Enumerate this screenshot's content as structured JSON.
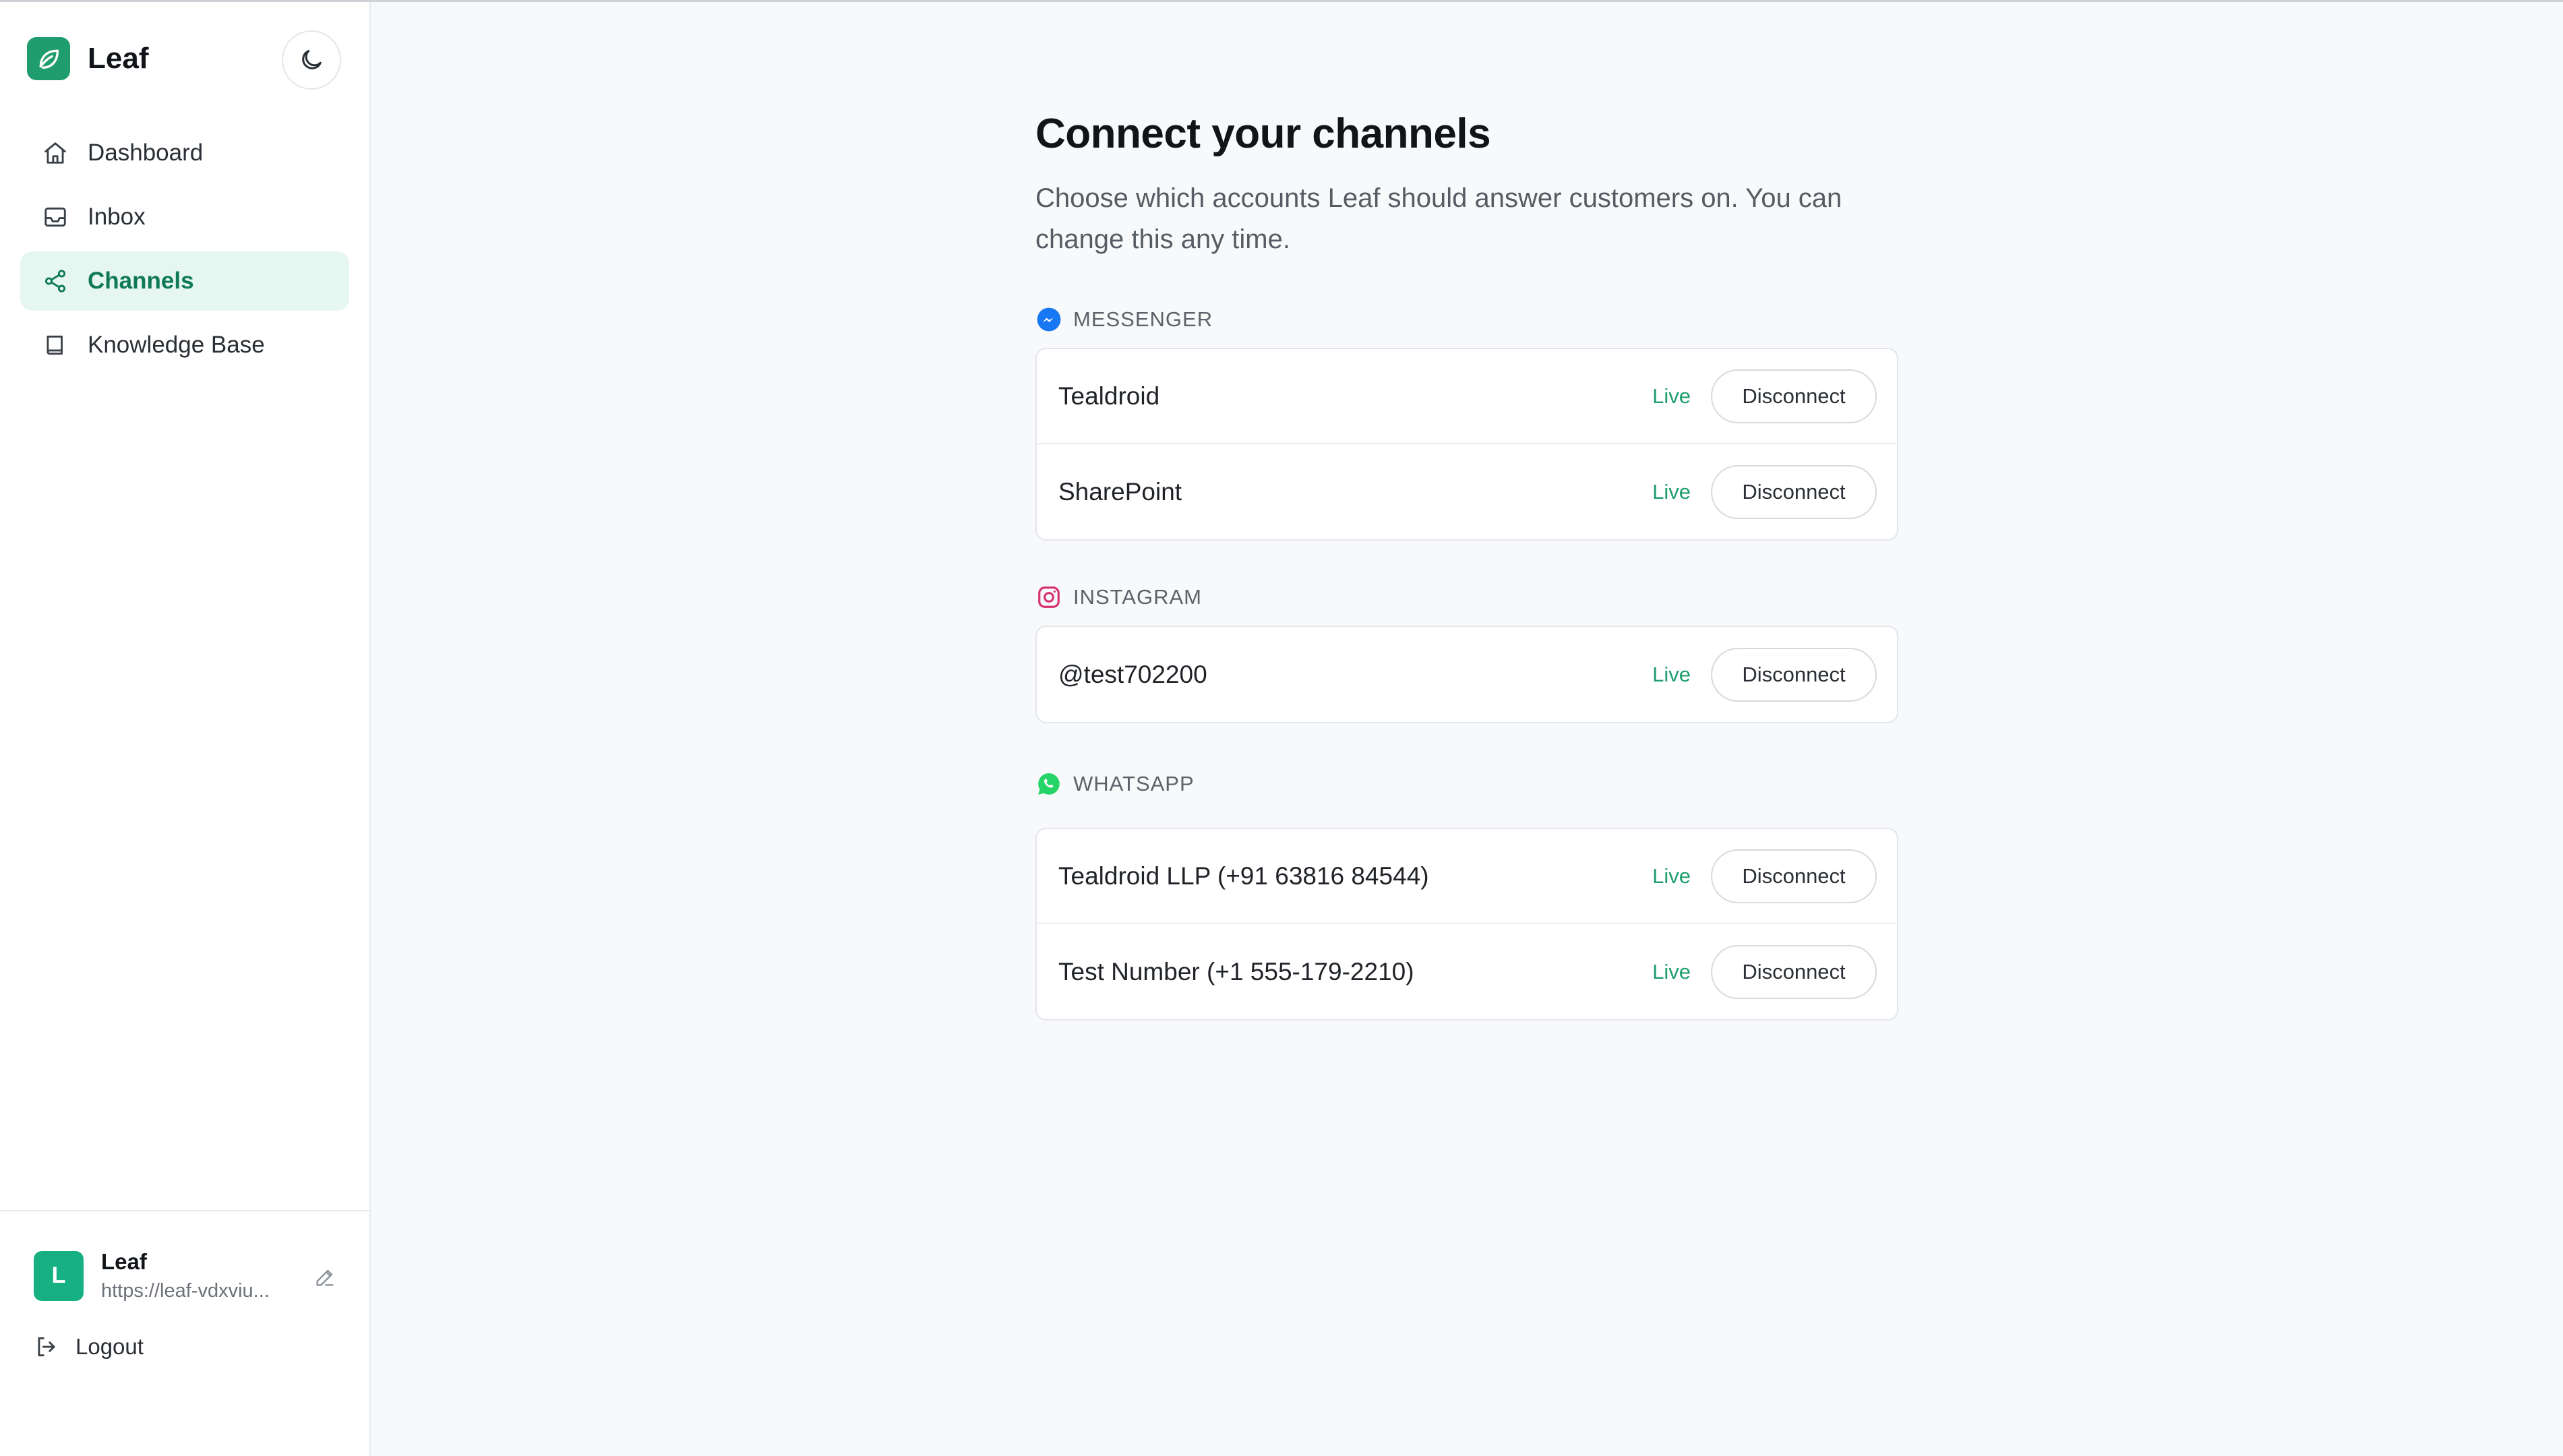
{
  "brand": {
    "name": "Leaf",
    "accent": "#1f9d6e"
  },
  "sidebar": {
    "items": [
      {
        "label": "Dashboard",
        "icon": "home-icon"
      },
      {
        "label": "Inbox",
        "icon": "inbox-icon"
      },
      {
        "label": "Channels",
        "icon": "share-icon",
        "active": true
      },
      {
        "label": "Knowledge Base",
        "icon": "book-icon"
      }
    ],
    "theme_toggle_icon": "moon-icon"
  },
  "account": {
    "avatar_letter": "L",
    "name": "Leaf",
    "url": "https://leaf-vdxviu..."
  },
  "logout_label": "Logout",
  "main": {
    "title": "Connect your channels",
    "subtitle": "Choose which accounts Leaf should answer customers on. You can change this any time.",
    "sections": [
      {
        "title": "MESSENGER",
        "icon": "messenger-icon",
        "rows": [
          {
            "name": "Tealdroid",
            "status": "Live",
            "action": "Disconnect"
          },
          {
            "name": "SharePoint",
            "status": "Live",
            "action": "Disconnect"
          }
        ]
      },
      {
        "title": "INSTAGRAM",
        "icon": "instagram-icon",
        "rows": [
          {
            "name": "@test702200",
            "status": "Live",
            "action": "Disconnect"
          }
        ]
      },
      {
        "title": "WHATSAPP",
        "icon": "whatsapp-icon",
        "rows": [
          {
            "name": "Tealdroid LLP (+91 63816 84544)",
            "status": "Live",
            "action": "Disconnect"
          },
          {
            "name": "Test Number (+1 555-179-2210)",
            "status": "Live",
            "action": "Disconnect"
          }
        ]
      }
    ]
  },
  "colors": {
    "live_status": "#1f9d6e",
    "active_nav_bg": "#e6f6f0",
    "active_nav_text": "#0f7a55",
    "avatar_bg": "#17b083"
  }
}
